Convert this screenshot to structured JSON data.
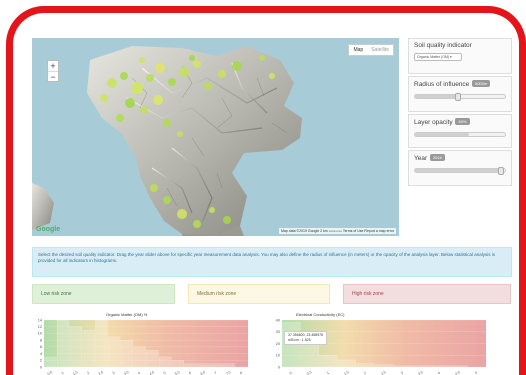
{
  "map": {
    "zoom_in": "+",
    "zoom_out": "−",
    "map_type": [
      "Map",
      "Satellite"
    ],
    "logo": "Google",
    "attribution": "Map data ©2019 Google    2 km ▭▭▭▭    Terms of Use    Report a map error"
  },
  "controls": {
    "soil_quality": {
      "title": "Soil quality indicator",
      "selected": "Organic Matter (OM) ▾"
    },
    "radius": {
      "title": "Radius of influence",
      "badge": "5000m",
      "level": 0.48
    },
    "opacity": {
      "title": "Layer opacity",
      "badge": "60%",
      "level": 0.6
    },
    "year": {
      "title": "Year",
      "badge": "2016",
      "level": 0.95
    }
  },
  "info_text": "Select the desired soil quality indicator. Drag the year slider above for specific year measurement data analysis. You may also define the radius of influence (in meters) or the opacity of the analysis layer. Below statistical analysis is provided for all indicators in histograms.",
  "risk_zones": {
    "low": "Low risk zone",
    "medium": "Medium risk zone",
    "high": "High risk zone"
  },
  "colors": {
    "low": "#dff0d8",
    "medium": "#fcf8e3",
    "high": "#f2dede",
    "info": "#d9edf7",
    "frame": "#e3141a"
  },
  "chart_data": [
    {
      "type": "bar",
      "title": "Organic Matter (OM) %",
      "ylim": [
        0,
        14
      ],
      "yticks": [
        "0",
        "2",
        "4",
        "6",
        "8",
        "10",
        "12",
        "14"
      ],
      "xticks": [
        "0.5",
        "1",
        "1.5",
        "2",
        "2.5",
        "3",
        "3.5",
        "4",
        "4.5",
        "5",
        "5.5",
        "6",
        "6.5",
        "7",
        "7.5",
        "8"
      ],
      "values": [
        3,
        14,
        12,
        11,
        14,
        9,
        8,
        6,
        5,
        3,
        2,
        1,
        1,
        1,
        1
      ]
    },
    {
      "type": "bar",
      "title": "Electrical Conductivity (EC)",
      "ylim": [
        0,
        40
      ],
      "yticks": [
        "0",
        "10",
        "20",
        "30",
        "40"
      ],
      "xticks": [
        "0",
        "0.5",
        "1",
        "1.5",
        "2",
        "2.5",
        "3",
        "3.5",
        "4",
        "4.5",
        "5"
      ],
      "values": [
        38,
        25,
        10,
        6,
        3,
        2,
        1,
        1,
        1,
        1
      ],
      "tooltip": {
        "line1": "37.356600, 23.458976",
        "line2": "mS/cm : 1.525"
      }
    }
  ]
}
